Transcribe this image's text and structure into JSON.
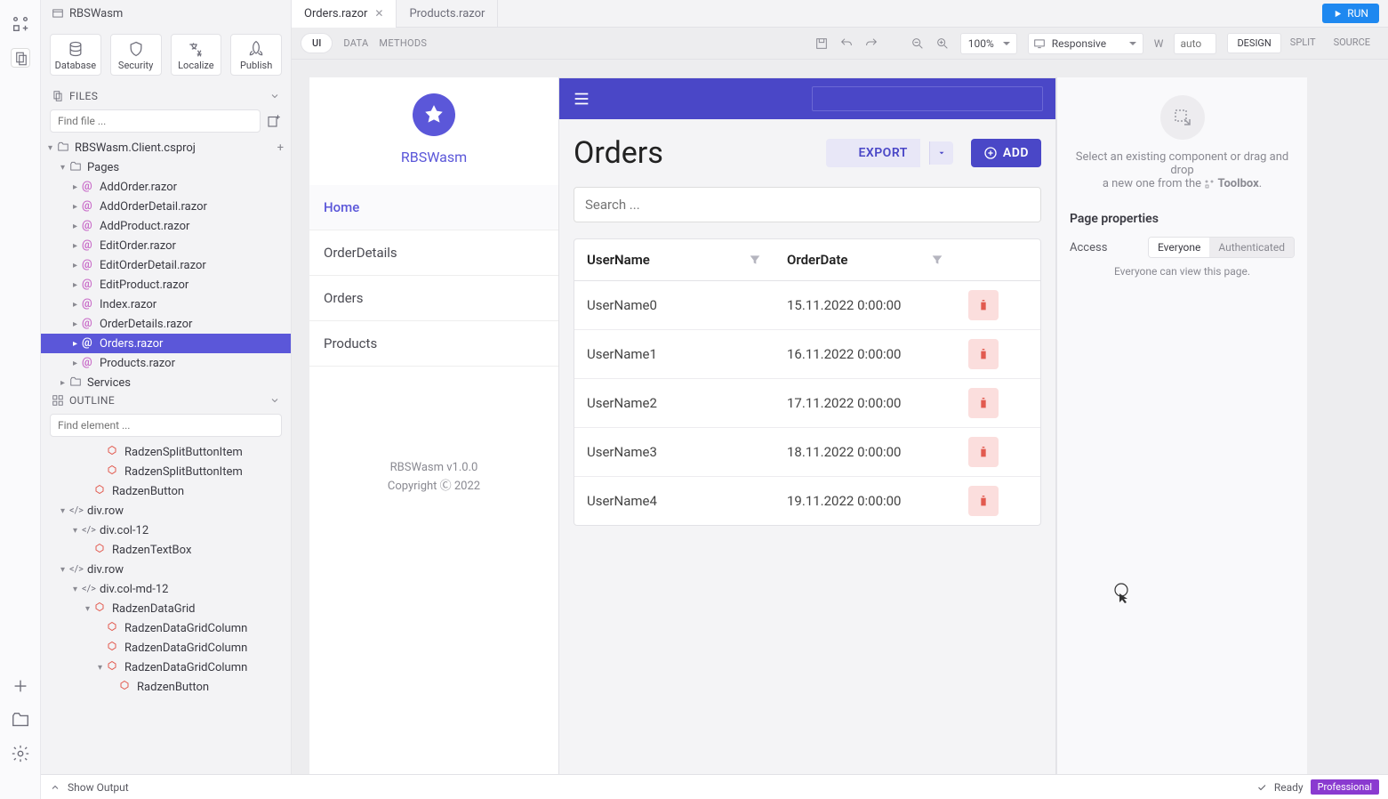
{
  "header": {
    "project": "RBSWasm"
  },
  "toolbar": {
    "database": "Database",
    "security": "Security",
    "localize": "Localize",
    "publish": "Publish"
  },
  "files": {
    "label": "FILES",
    "find_placeholder": "Find file ...",
    "root": "RBSWasm.Client.csproj",
    "pages_folder": "Pages",
    "pages": [
      "AddOrder.razor",
      "AddOrderDetail.razor",
      "AddProduct.razor",
      "EditOrder.razor",
      "EditOrderDetail.razor",
      "EditProduct.razor",
      "Index.razor",
      "OrderDetails.razor",
      "Orders.razor",
      "Products.razor"
    ],
    "services_folder": "Services"
  },
  "outline": {
    "label": "OUTLINE",
    "find_placeholder": "Find element ...",
    "items": [
      "RadzenSplitButtonItem",
      "RadzenSplitButtonItem",
      "RadzenButton",
      "div.row",
      "div.col-12",
      "RadzenTextBox",
      "div.row",
      "div.col-md-12",
      "RadzenDataGrid",
      "RadzenDataGridColumn",
      "RadzenDataGridColumn",
      "RadzenDataGridColumn",
      "RadzenButton"
    ]
  },
  "tabs": [
    {
      "name": "Orders.razor",
      "active": true
    },
    {
      "name": "Products.razor",
      "active": false
    }
  ],
  "run_label": "RUN",
  "designer": {
    "ui": "UI",
    "data": "DATA",
    "methods": "METHODS",
    "zoom": "100%",
    "responsive": "Responsive",
    "w_label": "W",
    "w_placeholder": "auto",
    "modes": [
      "DESIGN",
      "SPLIT",
      "SOURCE"
    ]
  },
  "app": {
    "brand": "RBSWasm",
    "nav": [
      "Home",
      "OrderDetails",
      "Orders",
      "Products"
    ],
    "footer_line1": "RBSWasm v1.0.0",
    "footer_line2": "Copyright Ⓒ 2022",
    "page_title": "Orders",
    "export_label": "EXPORT",
    "add_label": "ADD",
    "search_placeholder": "Search ...",
    "columns": [
      "UserName",
      "OrderDate"
    ],
    "rows": [
      {
        "user": "UserName0",
        "date": "15.11.2022 0:00:00"
      },
      {
        "user": "UserName1",
        "date": "16.11.2022 0:00:00"
      },
      {
        "user": "UserName2",
        "date": "17.11.2022 0:00:00"
      },
      {
        "user": "UserName3",
        "date": "18.11.2022 0:00:00"
      },
      {
        "user": "UserName4",
        "date": "19.11.2022 0:00:00"
      }
    ]
  },
  "props": {
    "hint1": "Select an existing component or drag and drop",
    "hint2": "a new one from the ",
    "hint3": "Toolbox",
    "section": "Page properties",
    "access_label": "Access",
    "everyone": "Everyone",
    "auth": "Authenticated",
    "note": "Everyone can view this page."
  },
  "status": {
    "show_output": "Show Output",
    "ready": "Ready",
    "pro": "Professional"
  }
}
